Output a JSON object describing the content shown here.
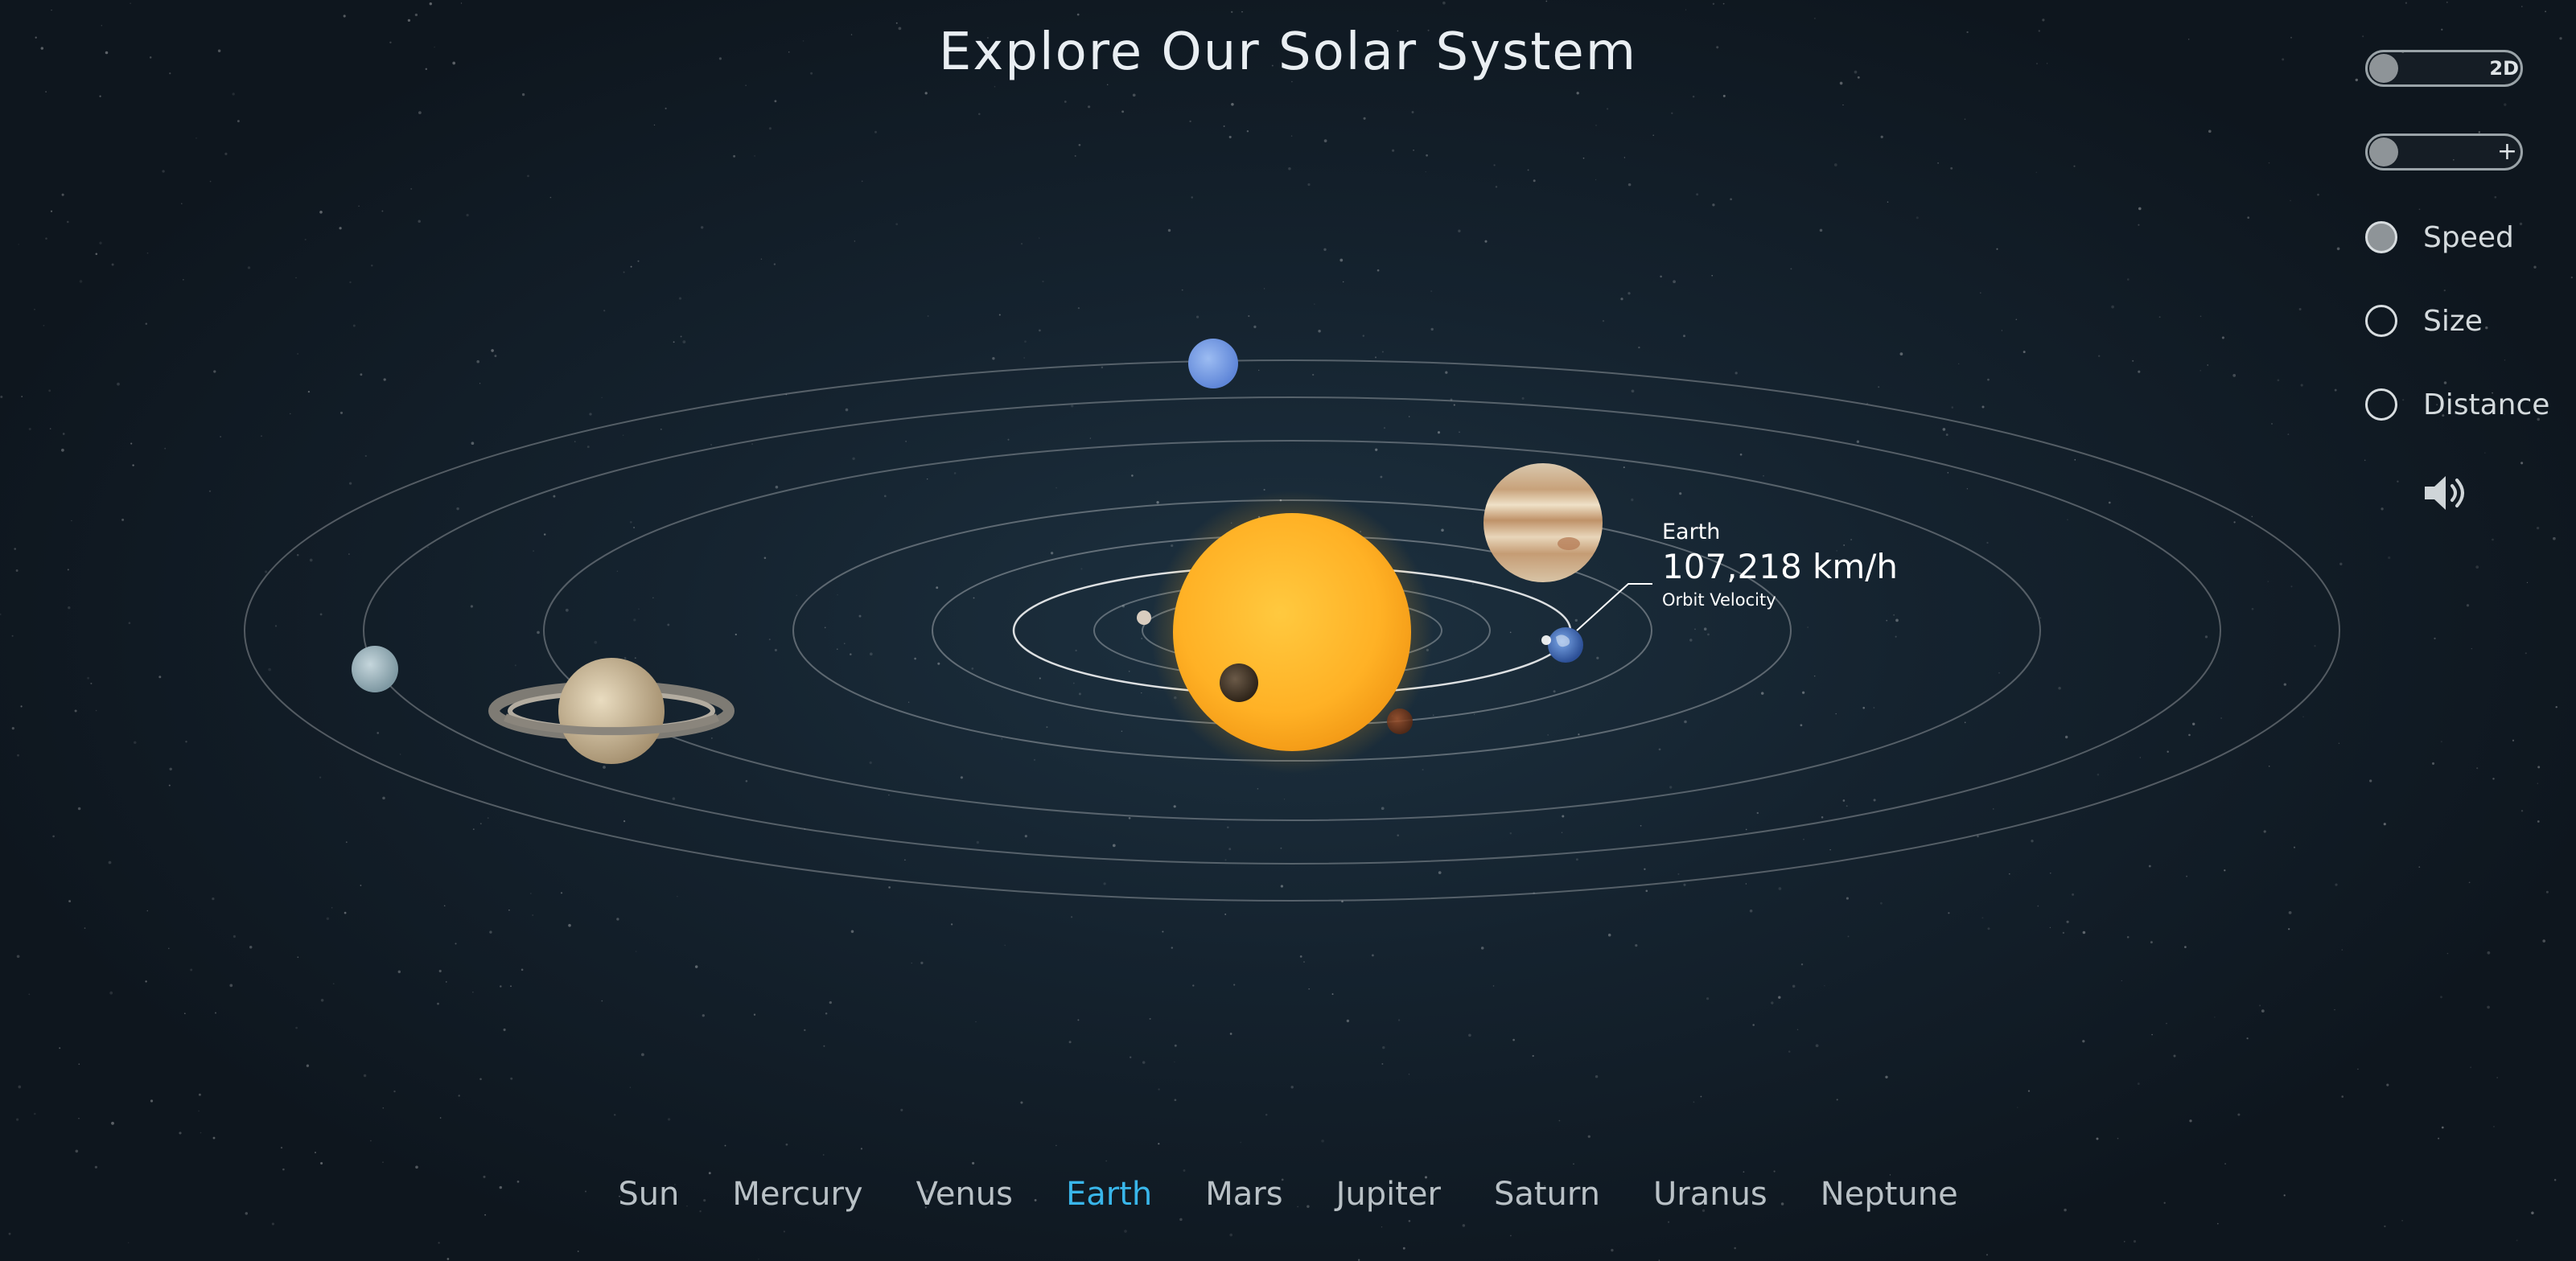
{
  "header": {
    "title": "Explore Our Solar System"
  },
  "controls": {
    "view_toggle_label": "2D",
    "zoom_toggle_label": "+",
    "options": [
      {
        "label": "Speed",
        "selected": true
      },
      {
        "label": "Size",
        "selected": false
      },
      {
        "label": "Distance",
        "selected": false
      }
    ],
    "sound_icon": "speaker-icon"
  },
  "tooltip": {
    "planet": "Earth",
    "value": "107,218 km/h",
    "metric": "Orbit Velocity"
  },
  "nav": {
    "items": [
      "Sun",
      "Mercury",
      "Venus",
      "Earth",
      "Mars",
      "Jupiter",
      "Saturn",
      "Uranus",
      "Neptune"
    ],
    "active": "Earth"
  },
  "colors": {
    "accent": "#39b6ea",
    "background": "#15232f",
    "sun": "#ffb326",
    "text": "#e9eef2"
  }
}
